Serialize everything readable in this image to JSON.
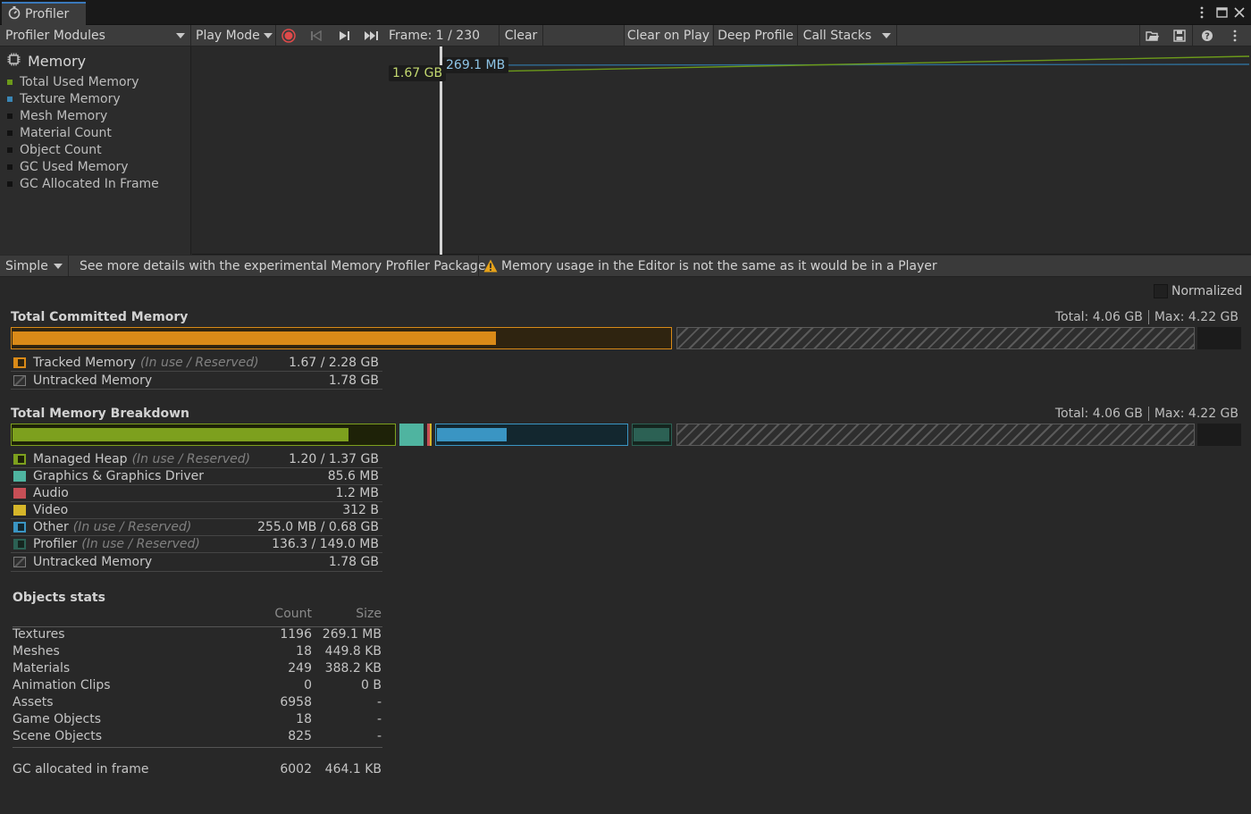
{
  "window": {
    "tab_title": "Profiler",
    "icons": [
      "more-vert-icon",
      "maximize-icon",
      "close-icon"
    ]
  },
  "toolbar": {
    "modules_label": "Profiler Modules",
    "target_label": "Play Mode",
    "frame_label": "Frame: 1 / 230",
    "clear_label": "Clear",
    "clear_on_play_label": "Clear on Play",
    "deep_profile_label": "Deep Profile",
    "call_stacks_label": "Call Stacks"
  },
  "module": {
    "title": "Memory",
    "items": [
      {
        "label": "Total Used Memory",
        "color": "#6c9a1a"
      },
      {
        "label": "Texture Memory",
        "color": "#3a86b5"
      },
      {
        "label": "Mesh Memory",
        "color": "#111111"
      },
      {
        "label": "Material Count",
        "color": "#111111"
      },
      {
        "label": "Object Count",
        "color": "#111111"
      },
      {
        "label": "GC Used Memory",
        "color": "#111111"
      },
      {
        "label": "GC Allocated In Frame",
        "color": "#111111"
      }
    ]
  },
  "chart": {
    "total_label": "1.67 GB",
    "texture_label": "269.1 MB"
  },
  "details_bar": {
    "view_mode": "Simple",
    "package_hint": "See more details with the experimental Memory Profiler Package.",
    "warning": "Memory usage in the Editor is not the same as it would be in a Player"
  },
  "normalized_label": "Normalized",
  "committed": {
    "title": "Total Committed Memory",
    "total": "Total: 4.06 GB",
    "max": "Max: 4.22 GB",
    "rows": [
      {
        "label": "Tracked Memory",
        "sub": "(In use / Reserved)",
        "value": "1.67 / 2.28 GB"
      },
      {
        "label": "Untracked Memory",
        "sub": "",
        "value": "1.78 GB"
      }
    ]
  },
  "breakdown": {
    "title": "Total Memory Breakdown",
    "total": "Total: 4.06 GB",
    "max": "Max: 4.22 GB",
    "rows": [
      {
        "label": "Managed Heap",
        "sub": "(In use / Reserved)",
        "value": "1.20 / 1.37 GB"
      },
      {
        "label": "Graphics & Graphics Driver",
        "sub": "",
        "value": "85.6 MB"
      },
      {
        "label": "Audio",
        "sub": "",
        "value": "1.2 MB"
      },
      {
        "label": "Video",
        "sub": "",
        "value": "312 B"
      },
      {
        "label": "Other",
        "sub": "(In use / Reserved)",
        "value": "255.0 MB / 0.68 GB"
      },
      {
        "label": "Profiler",
        "sub": "(In use / Reserved)",
        "value": "136.3 / 149.0 MB"
      },
      {
        "label": "Untracked Memory",
        "sub": "",
        "value": "1.78 GB"
      }
    ]
  },
  "objects": {
    "title": "Objects stats",
    "col_count": "Count",
    "col_size": "Size",
    "rows": [
      {
        "name": "Textures",
        "count": "1196",
        "size": "269.1 MB"
      },
      {
        "name": "Meshes",
        "count": "18",
        "size": "449.8 KB"
      },
      {
        "name": "Materials",
        "count": "249",
        "size": "388.2 KB"
      },
      {
        "name": "Animation Clips",
        "count": "0",
        "size": "0 B"
      },
      {
        "name": "Assets",
        "count": "6958",
        "size": "-"
      },
      {
        "name": "Game Objects",
        "count": "18",
        "size": "-"
      },
      {
        "name": "Scene Objects",
        "count": "825",
        "size": "-"
      }
    ],
    "gc_label": "GC allocated in frame",
    "gc_count": "6002",
    "gc_size": "464.1 KB"
  }
}
